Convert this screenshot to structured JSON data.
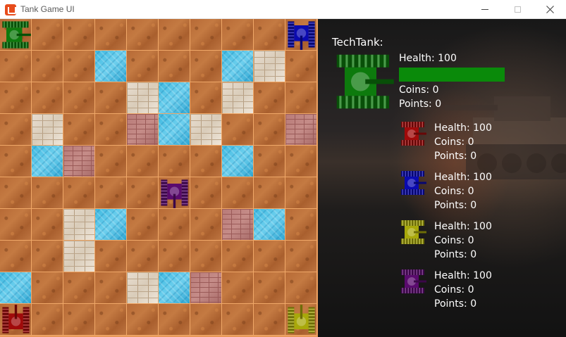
{
  "window": {
    "title": "Tank Game UI",
    "controls": {
      "minimize": "minimize",
      "maximize": "maximize",
      "close": "close"
    }
  },
  "board": {
    "rows": 10,
    "cols": 10,
    "tiles": [
      [
        "ground",
        "ground",
        "ground",
        "ground",
        "ground",
        "ground",
        "ground",
        "ground",
        "ground",
        "ground"
      ],
      [
        "ground",
        "ground",
        "ground",
        "water",
        "ground",
        "ground",
        "ground",
        "water",
        "stone",
        "ground"
      ],
      [
        "ground",
        "ground",
        "ground",
        "ground",
        "stone",
        "water",
        "ground",
        "stone",
        "ground",
        "ground"
      ],
      [
        "ground",
        "stone",
        "ground",
        "ground",
        "brick",
        "water",
        "stone",
        "ground",
        "ground",
        "brick"
      ],
      [
        "ground",
        "water",
        "brick",
        "ground",
        "ground",
        "ground",
        "ground",
        "water",
        "ground",
        "ground"
      ],
      [
        "ground",
        "ground",
        "ground",
        "ground",
        "ground",
        "ground",
        "ground",
        "ground",
        "ground",
        "ground"
      ],
      [
        "ground",
        "ground",
        "stone",
        "water",
        "ground",
        "ground",
        "ground",
        "brick",
        "water",
        "ground"
      ],
      [
        "ground",
        "ground",
        "stone",
        "ground",
        "ground",
        "ground",
        "ground",
        "ground",
        "ground",
        "ground"
      ],
      [
        "water",
        "ground",
        "ground",
        "ground",
        "stone",
        "water",
        "brick",
        "ground",
        "ground",
        "ground"
      ],
      [
        "ground",
        "ground",
        "ground",
        "ground",
        "ground",
        "ground",
        "ground",
        "ground",
        "ground",
        "ground"
      ]
    ],
    "tanks": [
      {
        "name": "green-tank",
        "row": 0,
        "col": 0,
        "color": "#0d7a0d",
        "facing": "right"
      },
      {
        "name": "blue-tank",
        "row": 0,
        "col": 9,
        "color": "#0a0ab0",
        "facing": "down"
      },
      {
        "name": "purple-tank",
        "row": 5,
        "col": 5,
        "color": "#5a0a6e",
        "facing": "down"
      },
      {
        "name": "red-tank",
        "row": 9,
        "col": 0,
        "color": "#a00a0a",
        "facing": "up"
      },
      {
        "name": "yellow-tank",
        "row": 9,
        "col": 9,
        "color": "#a8a80a",
        "facing": "up"
      }
    ]
  },
  "player": {
    "name": "TechTank:",
    "color": "#0d7a0d",
    "health_label": "Health: 100",
    "health_fraction": 1.0,
    "coins_label": "Coins: 0",
    "points_label": "Points: 0"
  },
  "opponents": [
    {
      "name": "red",
      "color": "#a00a0a",
      "health_label": "Health: 100",
      "coins_label": "Coins: 0",
      "points_label": "Points: 0"
    },
    {
      "name": "blue",
      "color": "#0a0ab0",
      "health_label": "Health: 100",
      "coins_label": "Coins: 0",
      "points_label": "Points: 0"
    },
    {
      "name": "yellow",
      "color": "#a8a80a",
      "health_label": "Health: 100",
      "coins_label": "Coins: 0",
      "points_label": "Points: 0"
    },
    {
      "name": "purple",
      "color": "#5a0a6e",
      "health_label": "Health: 100",
      "coins_label": "Coins: 0",
      "points_label": "Points: 0"
    }
  ],
  "colors": {
    "health_bar": "#0a8a0a",
    "ground": "#b76a36",
    "grid_line": "#f0a868",
    "water": "#3cb8e0",
    "stone": "#e0d4c4",
    "brick": "#b87a78"
  }
}
